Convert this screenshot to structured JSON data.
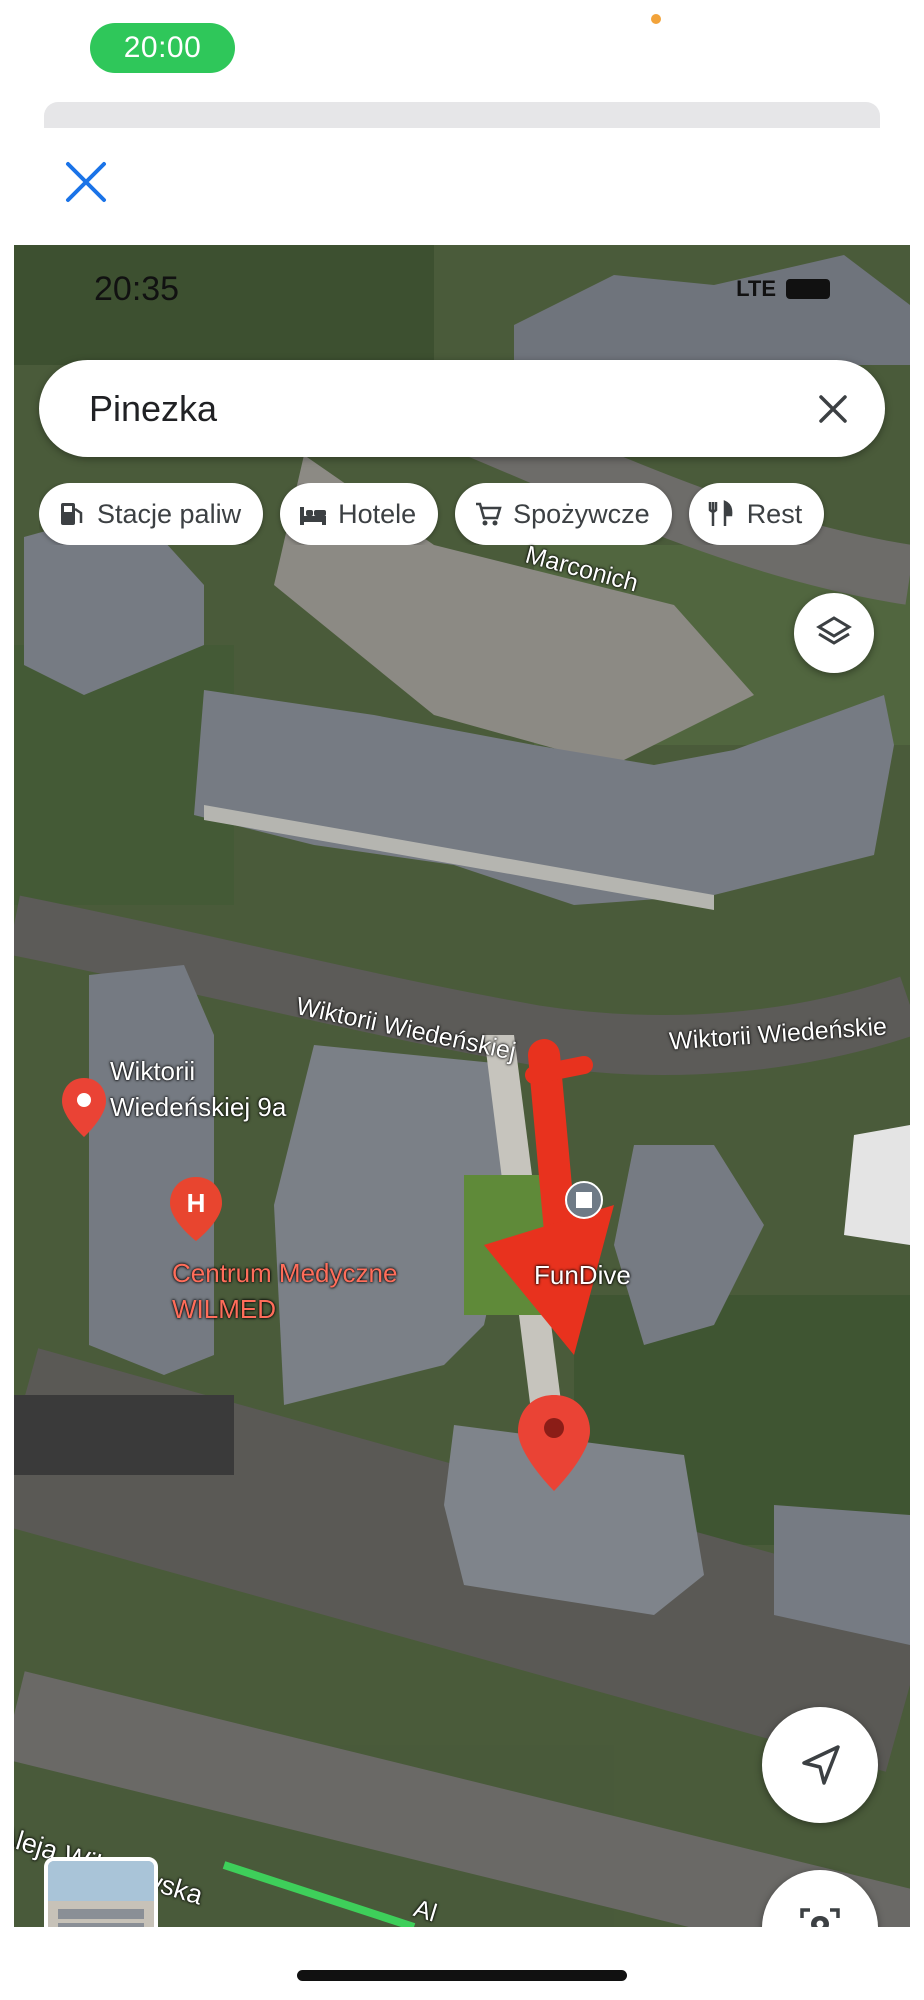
{
  "status_bar": {
    "time": "20:00"
  },
  "sheet": {
    "close_icon": "close-icon"
  },
  "map_screenshot": {
    "inner_status": {
      "time": "20:35",
      "network": "LTE"
    },
    "search": {
      "query": "Pinezka",
      "clear_icon": "close-icon"
    },
    "chips": [
      {
        "label": "Stacje paliw",
        "icon": "gas-station-icon"
      },
      {
        "label": "Hotele",
        "icon": "bed-icon"
      },
      {
        "label": "Spożywcze",
        "icon": "cart-icon"
      },
      {
        "label": "Rest",
        "icon": "restaurant-icon"
      }
    ],
    "labels": {
      "street_marconich": "Marconich",
      "street_wiktorii_1": "Wiktorii Wiedeńskiej",
      "street_wiktorii_2": "Wiktorii Wiedeńskie",
      "address_line1": "Wiktorii",
      "address_line2": "Wiedeńskiej 9a",
      "medical_line1": "Centrum Medyczne",
      "medical_line2": "WILMED",
      "fundive": "FunDive",
      "street_wilanowska": "Aleja Wilanowska",
      "street_al": "Al"
    },
    "colors": {
      "pin_red": "#ea4335",
      "arrow_red": "#e8321e",
      "route_green": "#3ecf5a"
    }
  }
}
